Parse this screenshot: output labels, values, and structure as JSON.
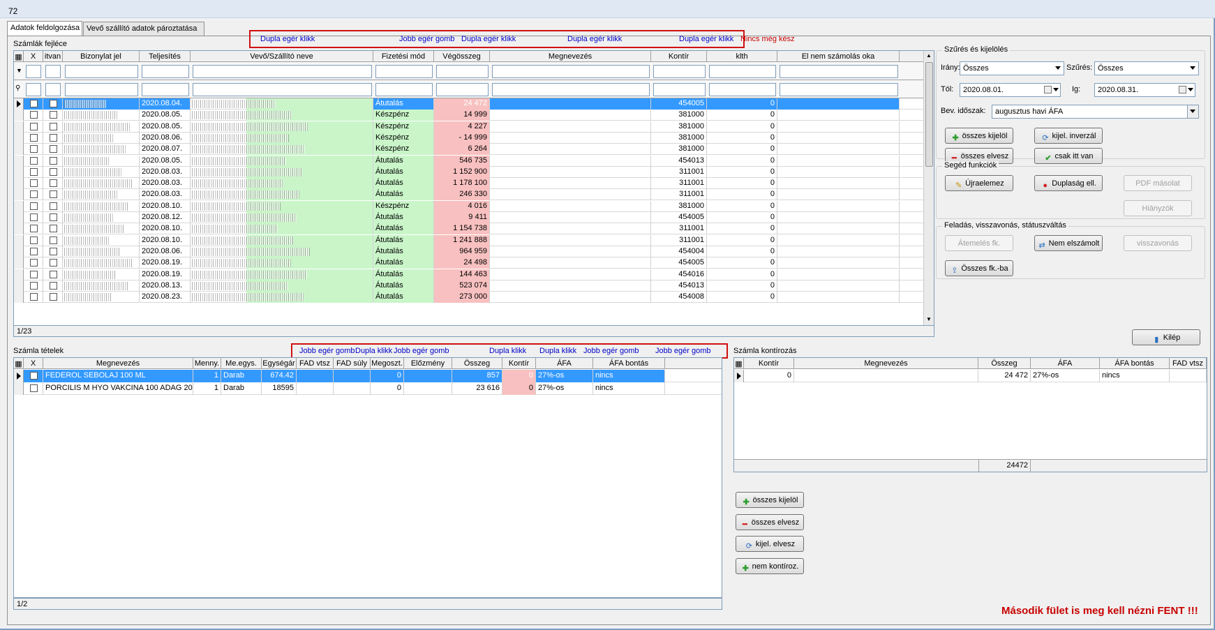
{
  "window": {
    "title": "72"
  },
  "tabs": [
    {
      "label": "Adatok feldolgozása"
    },
    {
      "label": "Vevő szállító adatok pároztatása"
    }
  ],
  "invoices": {
    "caption": "Számlák fejléce",
    "annotations": [
      "Dupla egér klikk",
      "Jobb egér gomb",
      "Dupla egér klikk",
      "Dupla egér klikk",
      "Dupla egér klikk"
    ],
    "note": "Nincs még kész",
    "columns": [
      "X",
      "itvan",
      "Bizonylat jel",
      "Teljesítés",
      "Vevő/Szállító neve",
      "Fizetési mód",
      "Végösszeg",
      "Megnevezés",
      "Kontír",
      "klth",
      "El nem számolás oka"
    ],
    "rows": [
      {
        "date": "2020.08.04.",
        "mode": "Átutalás",
        "total": "24 472",
        "kontir": "454005",
        "klth": "0"
      },
      {
        "date": "2020.08.05.",
        "mode": "Készpénz",
        "total": "14 999",
        "kontir": "381000",
        "klth": "0"
      },
      {
        "date": "2020.08.05.",
        "mode": "Készpénz",
        "total": "4 227",
        "kontir": "381000",
        "klth": "0"
      },
      {
        "date": "2020.08.06.",
        "mode": "Készpénz",
        "total": "- 14 999",
        "kontir": "381000",
        "klth": "0"
      },
      {
        "date": "2020.08.07.",
        "mode": "Készpénz",
        "total": "6 264",
        "kontir": "381000",
        "klth": "0"
      },
      {
        "date": "2020.08.05.",
        "mode": "Átutalás",
        "total": "546 735",
        "kontir": "454013",
        "klth": "0"
      },
      {
        "date": "2020.08.03.",
        "mode": "Átutalás",
        "total": "1 152 900",
        "kontir": "311001",
        "klth": "0"
      },
      {
        "date": "2020.08.03.",
        "mode": "Átutalás",
        "total": "1 178 100",
        "kontir": "311001",
        "klth": "0"
      },
      {
        "date": "2020.08.03.",
        "mode": "Átutalás",
        "total": "246 330",
        "kontir": "311001",
        "klth": "0"
      },
      {
        "date": "2020.08.10.",
        "mode": "Készpénz",
        "total": "4 016",
        "kontir": "381000",
        "klth": "0"
      },
      {
        "date": "2020.08.12.",
        "mode": "Átutalás",
        "total": "9 411",
        "kontir": "454005",
        "klth": "0"
      },
      {
        "date": "2020.08.10.",
        "mode": "Átutalás",
        "total": "1 154 738",
        "kontir": "311001",
        "klth": "0"
      },
      {
        "date": "2020.08.10.",
        "mode": "Átutalás",
        "total": "1 241 888",
        "kontir": "311001",
        "klth": "0"
      },
      {
        "date": "2020.08.06.",
        "mode": "Átutalás",
        "total": "964 959",
        "kontir": "454004",
        "klth": "0"
      },
      {
        "date": "2020.08.19.",
        "mode": "Átutalás",
        "total": "24 498",
        "kontir": "454005",
        "klth": "0"
      },
      {
        "date": "2020.08.19.",
        "mode": "Átutalás",
        "total": "144 463",
        "kontir": "454016",
        "klth": "0"
      },
      {
        "date": "2020.08.13.",
        "mode": "Átutalás",
        "total": "523 074",
        "kontir": "454013",
        "klth": "0"
      },
      {
        "date": "2020.08.23.",
        "mode": "Átutalás",
        "total": "273 000",
        "kontir": "454008",
        "klth": "0"
      }
    ],
    "status": "1/23"
  },
  "items": {
    "caption": "Számla tételek",
    "annotations": [
      "Jobb egér gomb",
      "Dupla klikk",
      "Jobb egér gomb",
      "Dupla klikk",
      "Dupla klikk",
      "Jobb egér gomb",
      "Jobb egér gomb"
    ],
    "columns": [
      "X",
      "Megnevezés",
      "Menny.",
      "Me.egys.",
      "Egységár",
      "FAD vtsz",
      "FAD súly",
      "Megoszt.",
      "Előzmény",
      "Összeg",
      "Kontír",
      "ÁFA",
      "ÁFA bontás"
    ],
    "rows": [
      {
        "name": "FEDEROL SEBOLAJ 100 ML",
        "qty": "1",
        "unit": "Darab",
        "price": "674.42",
        "megoszt": "0",
        "amount": "857",
        "kontir": "0",
        "afa": "27%-os",
        "bontas": "nincs"
      },
      {
        "name": "PORCILIS M HYO VAKCINA 100 ADAG 200",
        "qty": "1",
        "unit": "Darab",
        "price": "18595",
        "megoszt": "0",
        "amount": "23 616",
        "kontir": "0",
        "afa": "27%-os",
        "bontas": "nincs"
      }
    ],
    "status": "1/2"
  },
  "kontir": {
    "caption": "Számla kontírozás",
    "columns": [
      "Kontír",
      "Megnevezés",
      "Összeg",
      "ÁFA",
      "ÁFA bontás",
      "FAD vtsz"
    ],
    "rows": [
      {
        "kontir": "0",
        "amount": "24 472",
        "afa": "27%-os",
        "bontas": "nincs"
      }
    ],
    "total": "24472",
    "buttons": {
      "select_all": "összes kijelöl",
      "drop_all": "összes elvesz",
      "drop_selected": "kijel. elvesz",
      "no_kontir": "nem kontíroz."
    }
  },
  "filter": {
    "title": "Szűrés és kijelölés",
    "irany_label": "Irány:",
    "irany_value": "Összes",
    "szures_label": "Szűrés:",
    "szures_value": "Összes",
    "tol_label": "Tól:",
    "tol_value": "2020.08.01.",
    "ig_label": "Ig:",
    "ig_value": "2020.08.31.",
    "period_label": "Bev. időszak:",
    "period_value": "augusztus havi ÁFA",
    "buttons": {
      "select_all": "összes kijelöl",
      "invert": "kijel. inverzál",
      "drop_all": "összes elvesz",
      "only_here": "csak itt van"
    }
  },
  "helper": {
    "title": "Segéd funkciók",
    "buttons": {
      "reparse": "Újraelemez",
      "duplicate": "Duplaság ell.",
      "pdf": "PDF másolat",
      "missing": "Hiányzók"
    }
  },
  "posting": {
    "title": "Feladás, visszavonás, státuszváltás",
    "buttons": {
      "transfer": "Átemelés fk.",
      "not_settled": "Nem elszámolt",
      "revoke": "visszavonás",
      "all_to_fk": "Összes fk.-ba"
    }
  },
  "exit_label": "Kilép",
  "bottom_note": "Második fület is meg kell nézni FENT !!!",
  "colors": {
    "selection": "#3399ff",
    "pink": "#f8c0c0",
    "green": "#c9f5c9",
    "annotation_blue": "#0000c8",
    "annotation_red": "#c80000"
  }
}
